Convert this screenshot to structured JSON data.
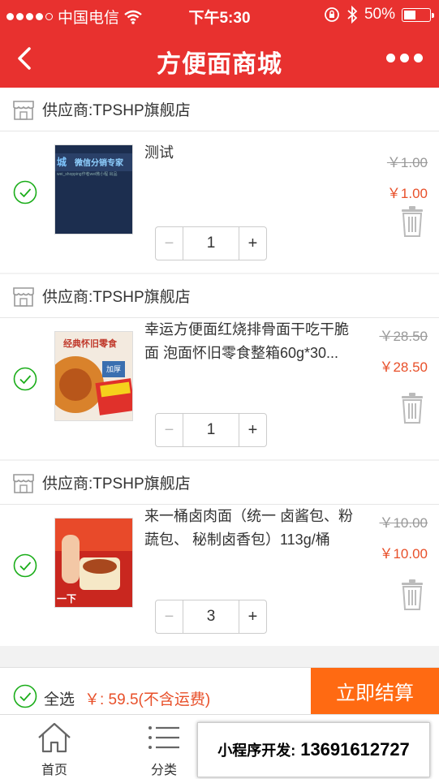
{
  "status_bar": {
    "carrier": "中国电信",
    "time": "下午5:30",
    "battery": "50%",
    "battery_level": 0.5
  },
  "header": {
    "title": "方便面商城",
    "back_icon": "chevron-left-icon",
    "more_icon": "more-dots-icon"
  },
  "colors": {
    "brand": "#e8312f",
    "price": "#e8502a",
    "checkout_button": "#ff6a12",
    "check": "#1aad19"
  },
  "stores": [
    {
      "supplier": "供应商:TPSHP旗舰店",
      "item": {
        "name": "测试",
        "original_price": "￥1.00",
        "price": "￥1.00",
        "quantity": "1",
        "thumb_text_main": "微信分销专家",
        "thumb_text_side": "城",
        "thumb_text_small": "wei_shopping作者wei微小程 出品"
      }
    },
    {
      "supplier": "供应商:TPSHP旗舰店",
      "item": {
        "name": "幸运方便面红烧排骨面干吃干脆面 泡面怀旧零食整箱60g*30...",
        "original_price": "￥28.50",
        "price": "￥28.50",
        "quantity": "1",
        "thumb_text_main": "经典怀旧零食",
        "thumb_text_side": "加厚"
      }
    },
    {
      "supplier": "供应商:TPSHP旗舰店",
      "item": {
        "name": "来一桶卤肉面（统一 卤酱包、粉蔬包、 秘制卤香包）113g/桶",
        "original_price": "￥10.00",
        "price": "￥10.00",
        "quantity": "3",
        "thumb_text_main": "",
        "thumb_text_side": "一下"
      }
    }
  ],
  "stepper": {
    "minus": "−",
    "plus": "+"
  },
  "checkout": {
    "select_all": "全选",
    "total": "￥: 59.5(不含运费)",
    "button": "立即结算"
  },
  "tabbar": {
    "items": [
      {
        "label": "首页",
        "icon": "home-icon"
      },
      {
        "label": "分类",
        "icon": "list-icon"
      }
    ]
  },
  "promo": {
    "label": "小程序开发:",
    "phone": "13691612727"
  }
}
